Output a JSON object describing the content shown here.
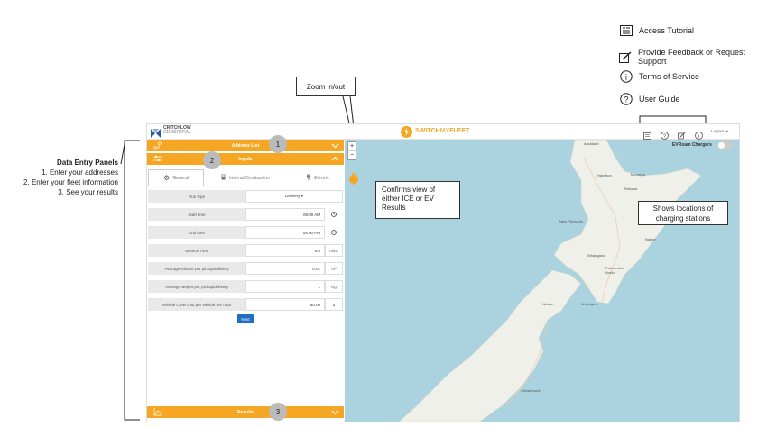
{
  "legend": {
    "access_tutorial": "Access Tutorial",
    "feedback": "Provide Feedback or Request Support",
    "terms": "Terms of Service",
    "guide": "User Guide"
  },
  "annotations": {
    "zoom": "Zoom in/out",
    "confirms_line1": "Confirms view of",
    "confirms_line2": "either ICE or EV",
    "confirms_line3": "Results",
    "shows_line1": "Shows locations of",
    "shows_line2": "charging stations",
    "data_entry_title": "Data Entry Panels",
    "step1": "1. Enter your addresses",
    "step2": "2. Enter your fleet information",
    "step3": "3. See your results",
    "num1": "1",
    "num2": "2",
    "num3": "3"
  },
  "header": {
    "brand_line1": "CRITCHLOW",
    "brand_line2": "GEOSPATIAL",
    "app_switch": "SWITCH",
    "app_my": "MY",
    "app_fleet": "FLEET",
    "logout": "Logout"
  },
  "panels": {
    "address_list": "Address List",
    "inputs": "Inputs",
    "results": "Results"
  },
  "tabs": {
    "general": "General",
    "ice": "Internal Combustion",
    "electric": "Electric"
  },
  "fields": [
    {
      "label": "Run type",
      "value": "Delivery ▾",
      "unit": ""
    },
    {
      "label": "Start time",
      "value": "09:00 AM",
      "unit": "clock"
    },
    {
      "label": "End time",
      "value": "05:00 PM",
      "unit": "clock"
    },
    {
      "label": "Service Time",
      "value": "5.0",
      "unit": "mins"
    },
    {
      "label": "Average volume per pickup/delivery",
      "value": "0.01",
      "unit": "m³"
    },
    {
      "label": "Average weight per pickup/delivery",
      "value": "1",
      "unit": "Kg"
    },
    {
      "label": "Vehicle Crew cost per vehicle per hour",
      "value": "60.00",
      "unit": "$"
    }
  ],
  "next_button": "Next",
  "map": {
    "ev_toggle_label": "EVRoam Chargers",
    "zoom_in": "+",
    "zoom_out": "−",
    "places": [
      "Auckland",
      "Hamilton",
      "Tauranga",
      "Rotorua",
      "Gisborne",
      "New Plymouth",
      "Napier",
      "Whanganui",
      "Palmerston North",
      "Nelson",
      "Wellington",
      "Christchurch"
    ]
  }
}
